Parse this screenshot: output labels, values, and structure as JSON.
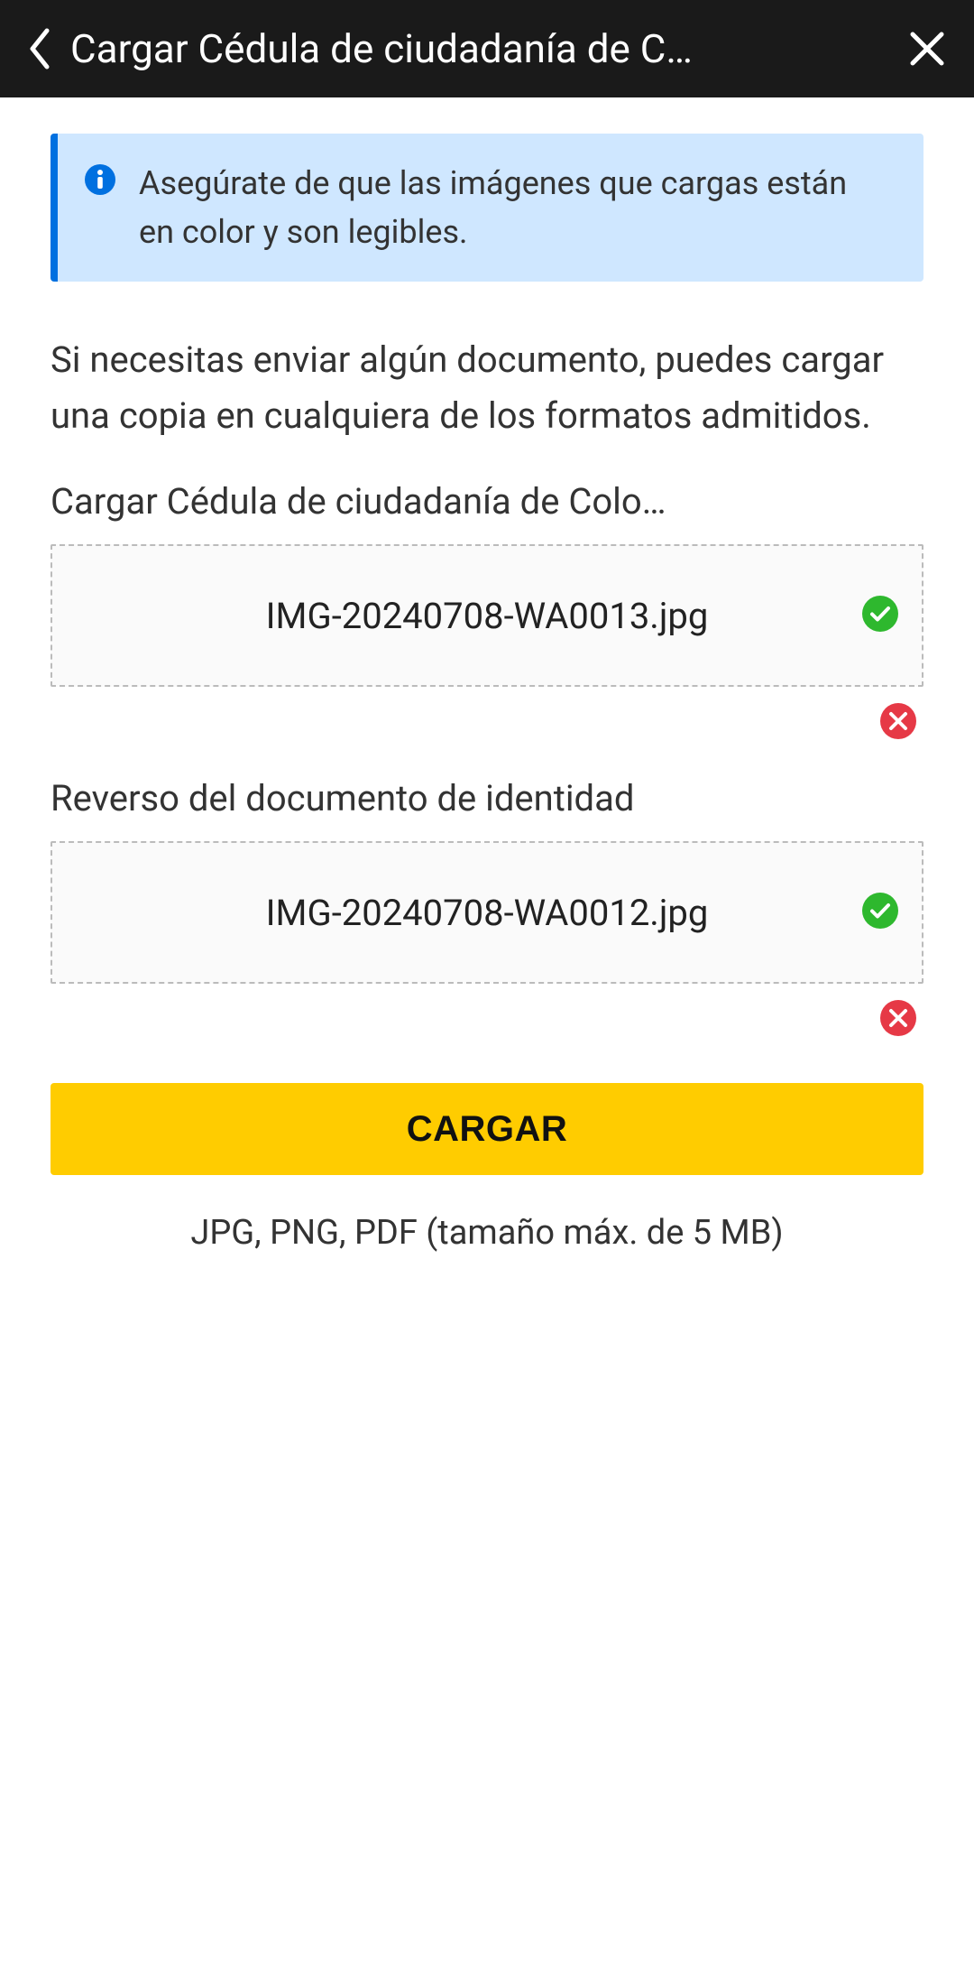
{
  "header": {
    "title": "Cargar Cédula de ciudadanía de C…"
  },
  "info_banner": {
    "text": "Asegúrate de que las imágenes que cargas están en color y son legibles."
  },
  "instruction": "Si necesitas enviar algún documento, puedes cargar una copia en cualquiera de los formatos admitidos.",
  "sections": {
    "front": {
      "label": "Cargar Cédula de ciudadanía de Colo…",
      "filename": "IMG-20240708-WA0013.jpg"
    },
    "back": {
      "label": "Reverso del documento de identidad",
      "filename": "IMG-20240708-WA0012.jpg"
    }
  },
  "upload_button": "CARGAR",
  "format_note": "JPG, PNG, PDF (tamaño máx. de 5 MB)"
}
